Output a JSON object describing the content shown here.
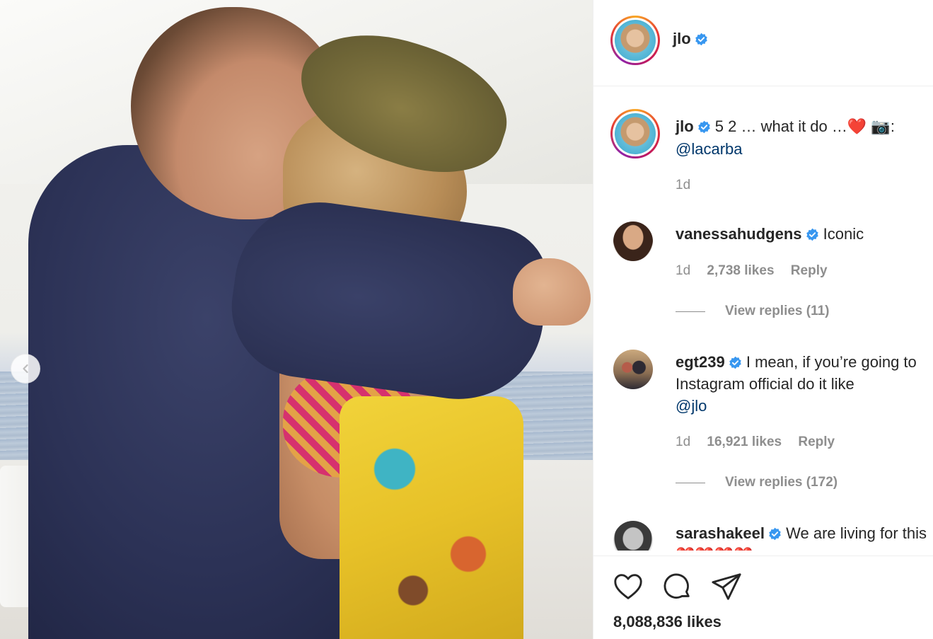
{
  "post": {
    "username": "jlo",
    "caption": {
      "username": "jlo",
      "text": "5 2 … what it do …",
      "emoji_heart": "❤️",
      "emoji_camera": "📷",
      "suffix": ":",
      "mention": "@lacarba",
      "time": "1d"
    },
    "likes": "8,088,836 likes"
  },
  "comments": [
    {
      "username": "vanessahudgens",
      "text": "Iconic",
      "mention": "",
      "time": "1d",
      "likes": "2,738 likes",
      "reply_label": "Reply",
      "view_replies": "View replies (11)"
    },
    {
      "username": "egt239",
      "text": "I mean, if you’re going to Instagram official do it like",
      "mention": "@jlo",
      "time": "1d",
      "likes": "16,921 likes",
      "reply_label": "Reply",
      "view_replies": "View replies (172)"
    },
    {
      "username": "sarashakeel",
      "text": "We are living for this ❤️❤️❤️❤️",
      "mention": ""
    }
  ],
  "icons": {
    "verified": "verified-badge-icon",
    "like": "heart-icon",
    "comment": "comment-icon",
    "share": "share-icon",
    "prev": "chevron-left-icon"
  },
  "colors": {
    "verified_blue": "#3897f0",
    "link": "#00376b",
    "muted": "#8e8e8e"
  }
}
